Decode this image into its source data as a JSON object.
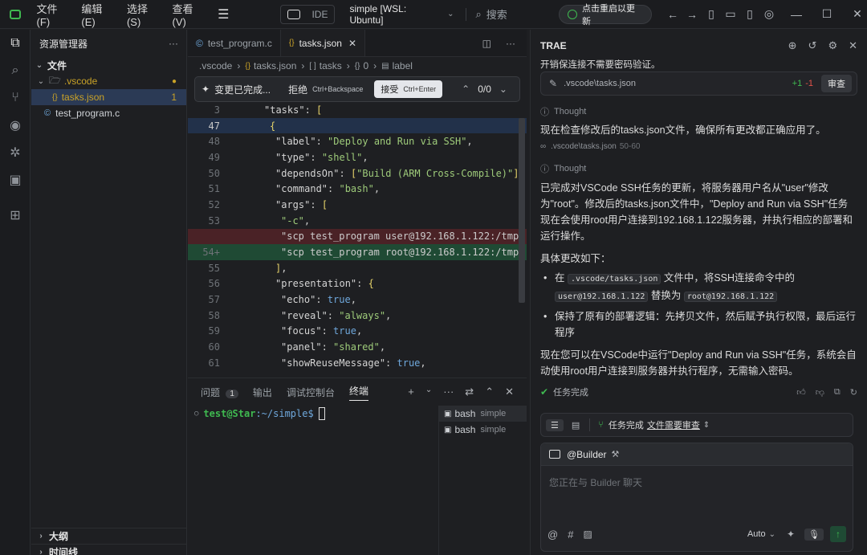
{
  "titlebar": {
    "menus": [
      "文件(F)",
      "编辑(E)",
      "选择(S)",
      "查看(V)"
    ],
    "ide_label": "IDE",
    "workspace": "simple [WSL: Ubuntu]",
    "search_placeholder": "搜索",
    "restart_label": "点击重启以更新"
  },
  "explorer": {
    "title": "资源管理器",
    "section": "文件",
    "vscode_folder": ".vscode",
    "tasks_file": "tasks.json",
    "tasks_badge": "1",
    "c_file": "test_program.c",
    "outline": "大纲",
    "timeline": "时间线"
  },
  "editor": {
    "tabs": [
      "test_program.c",
      "tasks.json"
    ],
    "breadcrumb": [
      ".vscode",
      "tasks.json",
      "tasks",
      "0",
      "label"
    ],
    "diffbar": {
      "changes": "变更已完成...",
      "reject": "拒绝",
      "reject_key": "Ctrl+Backspace",
      "accept": "接受",
      "accept_key": "Ctrl+Enter",
      "counter": "0/0"
    },
    "lines": [
      {
        "n": "3",
        "t": "\"tasks\": ["
      },
      {
        "n": "47",
        "t": "{"
      },
      {
        "n": "48",
        "t": "\"label\": \"Deploy and Run via SSH\","
      },
      {
        "n": "49",
        "t": "\"type\": \"shell\","
      },
      {
        "n": "50",
        "t": "\"dependsOn\": [\"Build (ARM Cross-Compile)\"],"
      },
      {
        "n": "51",
        "t": "\"command\": \"bash\","
      },
      {
        "n": "52",
        "t": "\"args\": ["
      },
      {
        "n": "53",
        "t": "\"-c\","
      },
      {
        "n": "",
        "t": "\"scp test_program user@192.168.1.122:/tmp/"
      },
      {
        "n": "54+",
        "t": "\"scp test_program root@192.168.1.122:/tmp/"
      },
      {
        "n": "55",
        "t": "],"
      },
      {
        "n": "56",
        "t": "\"presentation\": {"
      },
      {
        "n": "57",
        "t": "\"echo\": true,"
      },
      {
        "n": "58",
        "t": "\"reveal\": \"always\","
      },
      {
        "n": "59",
        "t": "\"focus\": true,"
      },
      {
        "n": "60",
        "t": "\"panel\": \"shared\","
      },
      {
        "n": "61",
        "t": "\"showReuseMessage\": true,"
      }
    ]
  },
  "panel": {
    "tabs": [
      "问题",
      "输出",
      "调试控制台",
      "终端"
    ],
    "problems_count": "1",
    "prompt_user": "test@Star",
    "prompt_path": ":~/simple$",
    "terminals": [
      {
        "name": "bash",
        "dir": "simple"
      },
      {
        "name": "bash",
        "dir": "simple"
      }
    ]
  },
  "chat": {
    "title": "TRAE",
    "top_text": "开销保连接不需要密码验证。",
    "file_chip": ".vscode\\tasks.json",
    "diff_add": "+1",
    "diff_del": "-1",
    "review_btn": "审查",
    "thought1": "Thought",
    "msg1": "现在检查修改后的tasks.json文件，确保所有更改都正确应用了。",
    "ref_file": ".vscode\\tasks.json",
    "ref_range": "50-60",
    "thought2": "Thought",
    "msg2": "已完成对VSCode SSH任务的更新，将服务器用户名从\"user\"修改为\"root\"。修改后的tasks.json文件中，\"Deploy and Run via SSH\"任务现在会使用root用户连接到192.168.1.122服务器，并执行相应的部署和运行操作。",
    "details_title": "具体更改如下：",
    "b1_pre": "在 ",
    "b1_code1": ".vscode/tasks.json",
    "b1_mid": " 文件中，将SSH连接命令中的",
    "b1_code2": "user@192.168.1.122",
    "b1_mid2": " 替换为 ",
    "b1_code3": "root@192.168.1.122",
    "b2": "保持了原有的部署逻辑：先拷贝文件，然后赋予执行权限，最后运行程序",
    "msg3": "现在您可以在VSCode中运行\"Deploy and Run via SSH\"任务，系统会自动使用root用户连接到服务器并执行程序，无需输入密码。",
    "done": "任务完成",
    "status_done": "任务完成",
    "status_review": "文件需要审查",
    "builder": "@Builder",
    "input_placeholder": "您正在与 Builder 聊天",
    "model": "Auto"
  },
  "colors": {
    "accent_green": "#3fb950",
    "diff_del_bg": "#4a2226",
    "diff_add_bg": "#1f4a34",
    "selected": "#2b3a55"
  }
}
